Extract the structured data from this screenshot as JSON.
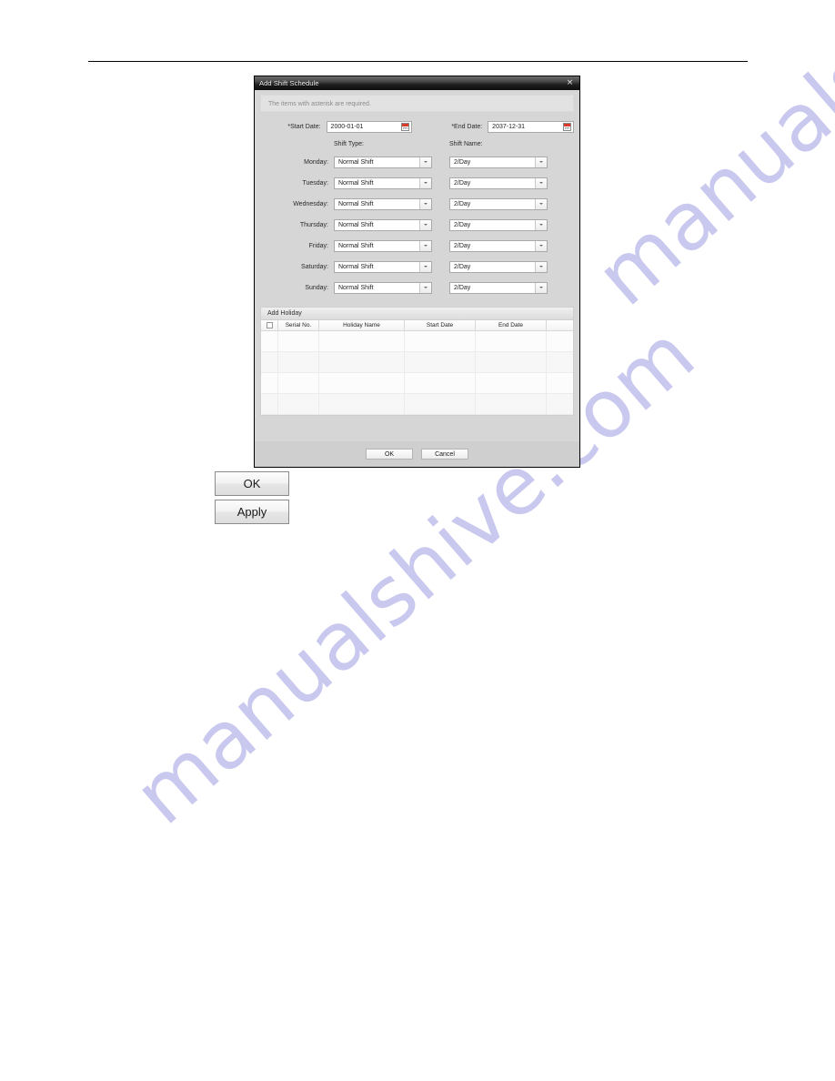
{
  "watermark": {
    "text": "manualshive.com",
    "color": "#c9c8ee"
  },
  "dialog": {
    "title": "Add Shift Schedule",
    "close_icon": "×",
    "notice": "The items with asterisk are required.",
    "start_date": {
      "label": "*Start Date:",
      "value": "2000-01-01",
      "calendar_icon": "calendar-icon"
    },
    "end_date": {
      "label": "*End Date:",
      "value": "2037-12-31",
      "calendar_icon": "calendar-icon"
    },
    "columns": {
      "shift_type": "Shift Type:",
      "shift_name": "Shift Name:"
    },
    "days": [
      {
        "label": "Monday:",
        "shift_type": "Normal Shift",
        "shift_name": "2/Day"
      },
      {
        "label": "Tuesday:",
        "shift_type": "Normal Shift",
        "shift_name": "2/Day"
      },
      {
        "label": "Wednesday:",
        "shift_type": "Normal Shift",
        "shift_name": "2/Day"
      },
      {
        "label": "Thursday:",
        "shift_type": "Normal Shift",
        "shift_name": "2/Day"
      },
      {
        "label": "Friday:",
        "shift_type": "Normal Shift",
        "shift_name": "2/Day"
      },
      {
        "label": "Saturday:",
        "shift_type": "Normal Shift",
        "shift_name": "2/Day"
      },
      {
        "label": "Sunday:",
        "shift_type": "Normal Shift",
        "shift_name": "2/Day"
      }
    ],
    "holiday": {
      "section_title": "Add Holiday",
      "headers": [
        "",
        "Serial No.",
        "Holiday Name",
        "Start Date",
        "End Date",
        ""
      ],
      "rows": [
        [],
        [],
        [],
        []
      ]
    },
    "footer": {
      "ok": "OK",
      "cancel": "Cancel"
    }
  },
  "page_buttons": {
    "ok": "OK",
    "apply": "Apply"
  }
}
